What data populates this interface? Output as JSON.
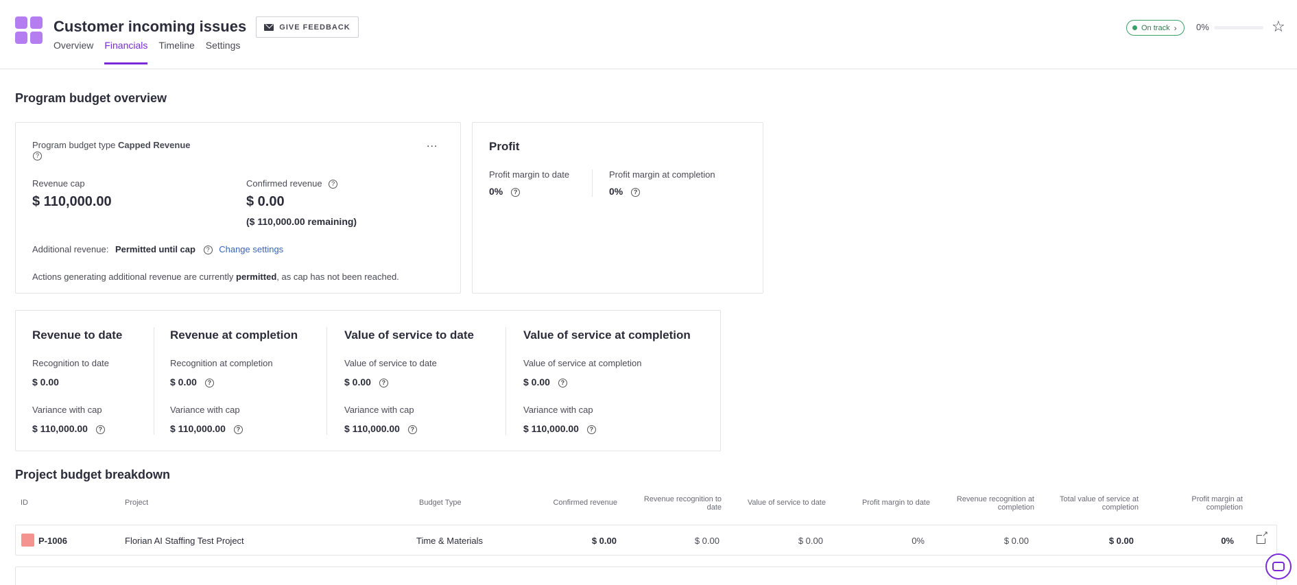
{
  "header": {
    "title": "Customer incoming issues",
    "feedback_label": "GIVE FEEDBACK",
    "tabs": [
      {
        "label": "Overview"
      },
      {
        "label": "Financials"
      },
      {
        "label": "Timeline"
      },
      {
        "label": "Settings"
      }
    ],
    "status": "On track",
    "progress_label": "0%",
    "progress_value": 0
  },
  "overview": {
    "title": "Program budget overview",
    "budget_type_label": "Program budget type",
    "budget_type_value": "Capped Revenue",
    "more_label": "...",
    "revenue_cap_label": "Revenue cap",
    "revenue_cap_value": "$ 110,000.00",
    "confirmed_label": "Confirmed revenue",
    "confirmed_value": "$ 0.00",
    "remaining_value": "($ 110,000.00 remaining)",
    "additional_label": "Additional revenue:",
    "additional_value": "Permitted until cap",
    "change_settings": "Change settings",
    "note_prefix": "Actions generating additional revenue are currently",
    "note_bold": "permitted",
    "note_suffix": ", as cap has not been reached."
  },
  "profit": {
    "title": "Profit",
    "to_date_label": "Profit margin to date",
    "to_date_value": "0%",
    "completion_label": "Profit margin at completion",
    "completion_value": "0%"
  },
  "summary": [
    {
      "title": "Revenue to date",
      "label1": "Recognition to date",
      "value1": "$ 0.00",
      "label2": "Variance with cap",
      "value2": "$ 110,000.00"
    },
    {
      "title": "Revenue at completion",
      "label1": "Recognition at completion",
      "value1": "$ 0.00",
      "label2": "Variance with cap",
      "value2": "$ 110,000.00"
    },
    {
      "title": "Value of service to date",
      "label1": "Value of service to date",
      "value1": "$ 0.00",
      "label2": "Variance with cap",
      "value2": "$ 110,000.00"
    },
    {
      "title": "Value of service at completion",
      "label1": "Value of service at completion",
      "value1": "$ 0.00",
      "label2": "Variance with cap",
      "value2": "$ 110,000.00"
    }
  ],
  "breakdown": {
    "title": "Project budget breakdown",
    "columns": {
      "id": "ID",
      "project": "Project",
      "budget_type": "Budget Type",
      "confirmed_revenue": "Confirmed revenue",
      "rev_rec_to_date_1": "Revenue recognition to",
      "rev_rec_to_date_2": "date",
      "vos_to_date": "Value of service to date",
      "pm_to_date": "Profit margin to date",
      "rev_rec_completion_1": "Revenue recognition at",
      "rev_rec_completion_2": "completion",
      "total_vos_1": "Total value of service at",
      "total_vos_2": "completion",
      "pm_completion_1": "Profit margin at",
      "pm_completion_2": "completion"
    },
    "rows": [
      {
        "id": "P-1006",
        "color": "#f4938f",
        "project": "Florian AI Staffing Test Project",
        "budget_type": "Time & Materials",
        "confirmed_revenue": "$ 0.00",
        "rev_rec_to_date": "$ 0.00",
        "vos_to_date": "$ 0.00",
        "pm_to_date": "0%",
        "rev_rec_completion": "$ 0.00",
        "total_vos": "$ 0.00",
        "pm_completion": "0%"
      }
    ]
  }
}
